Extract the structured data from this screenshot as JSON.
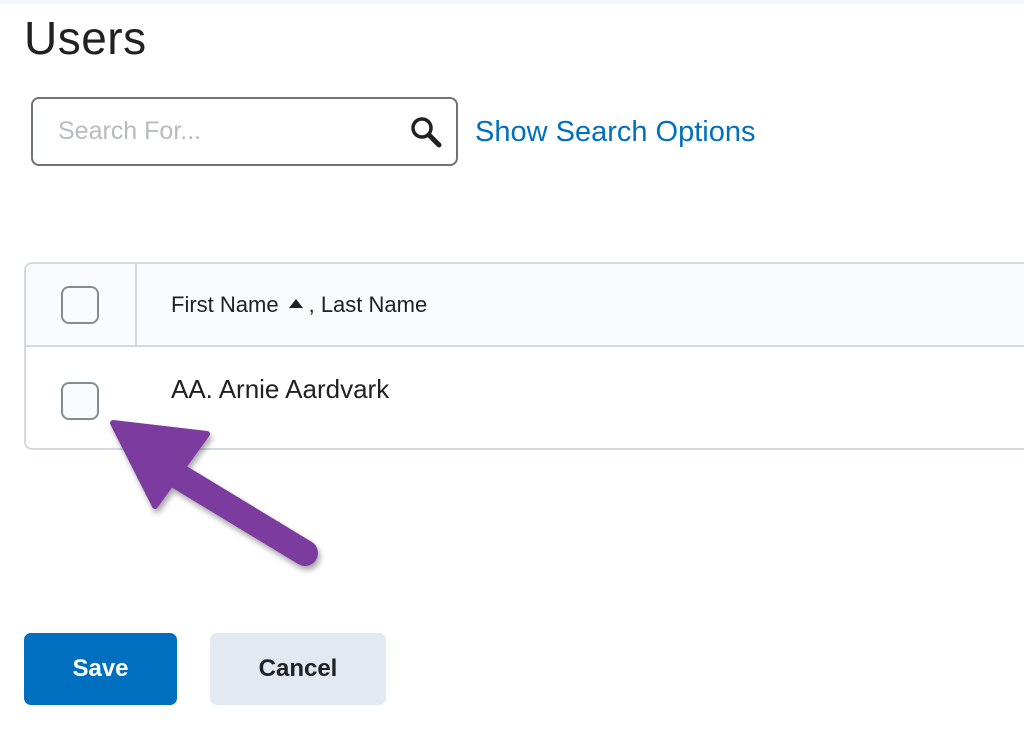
{
  "page": {
    "title": "Users"
  },
  "search": {
    "placeholder": "Search For...",
    "value": "",
    "options_link": "Show Search Options"
  },
  "grid": {
    "columns": {
      "first_name": "First Name",
      "separator": ",",
      "last_name": "Last Name",
      "sort": "ascending"
    },
    "rows": [
      {
        "name": "AA. Arnie Aardvark",
        "selected": false
      }
    ],
    "select_all_checked": false
  },
  "annotation": {
    "arrow_color": "#7b3b9e",
    "points_to": "row-checkbox"
  },
  "actions": {
    "save_label": "Save",
    "cancel_label": "Cancel"
  },
  "colors": {
    "link": "#006fbf",
    "primary_button": "#006fbf",
    "secondary_button": "#e3e9f1",
    "border": "#d3d9e3"
  }
}
